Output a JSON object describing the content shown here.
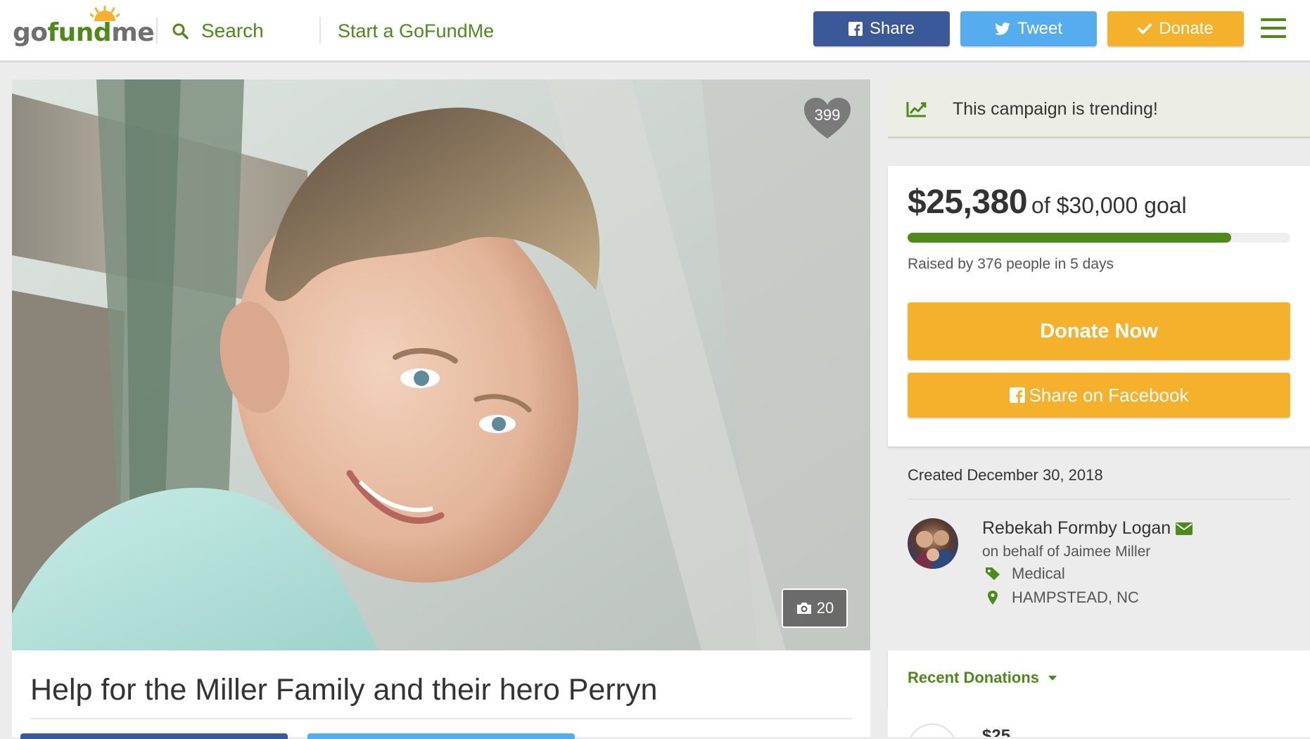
{
  "header": {
    "logo": {
      "go": "go",
      "fund": "fund",
      "me": "me"
    },
    "search_label": "Search",
    "start_label": "Start a GoFundMe",
    "buttons": {
      "share": "Share",
      "tweet": "Tweet",
      "donate": "Donate"
    },
    "colors": {
      "facebook": "#3b5998",
      "twitter": "#55acee",
      "donate": "#f6b12c",
      "brand_green": "#4e8a18"
    }
  },
  "hero": {
    "hearts_count": "399",
    "photo_count": "20",
    "title": "Help for the Miller Family and their hero Perryn"
  },
  "sidebar": {
    "trending": "This campaign is trending!",
    "raised": "$25,380",
    "goal_text": "of $30,000 goal",
    "progress_fraction": 0.846,
    "raised_by": "Raised by 376 people in 5 days",
    "donate_now": "Donate Now",
    "share_facebook": "Share on Facebook",
    "created": "Created December 30, 2018",
    "organizer": "Rebekah Formby Logan",
    "on_behalf": "on behalf of Jaimee Miller",
    "category": "Medical",
    "location": "HAMPSTEAD, NC",
    "recent_donations": "Recent Donations",
    "first_donation_amount": "$25"
  },
  "icons": {
    "search": "search-icon",
    "facebook": "facebook-icon",
    "twitter": "twitter-icon",
    "check": "check-icon",
    "menu": "hamburger-menu-icon",
    "heart": "heart-icon",
    "camera": "camera-icon",
    "trend": "trending-chart-icon",
    "mail": "envelope-icon",
    "tag": "tag-icon",
    "pin": "map-pin-icon",
    "caret": "caret-down-icon"
  }
}
